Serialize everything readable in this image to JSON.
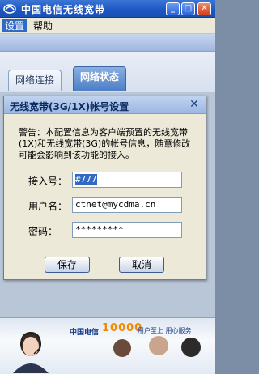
{
  "window": {
    "title": "中国电信无线宽带"
  },
  "menu": {
    "items": [
      "设置",
      "帮助"
    ]
  },
  "tabs": [
    "网络连接",
    "网络状态"
  ],
  "dialog": {
    "title": "无线宽带(3G/1X)帐号设置",
    "warning": "警告：本配置信息为客户端预置的无线宽带(1X)和无线宽带(3G)的帐号信息，随意修改可能会影响到该功能的接入。",
    "fields": [
      {
        "label": "接入号：",
        "value": "#777"
      },
      {
        "label": "用户名：",
        "value": "ctnet@mycdma.cn"
      },
      {
        "label": "密码：",
        "value": "*********"
      }
    ],
    "save_label": "保存",
    "cancel_label": "取消"
  },
  "banner": {
    "brand": "中国电信",
    "number": "10000",
    "slogan": "用户至上 用心服务"
  },
  "colors": {
    "titlebar": "#1c56c2",
    "accent": "#316ac5",
    "banner_number": "#f08a00"
  }
}
